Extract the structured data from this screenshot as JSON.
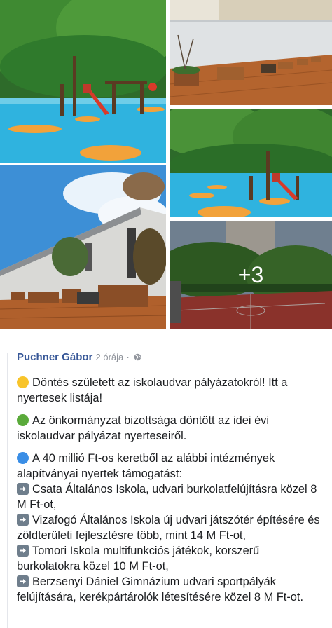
{
  "gallery": {
    "more_count": "+3",
    "photos": [
      {
        "name": "photo-playground-1",
        "desc_icon": "playground-icon"
      },
      {
        "name": "photo-courtyard-planters",
        "desc_icon": "planter-icon"
      },
      {
        "name": "photo-building-planters",
        "desc_icon": "building-icon"
      },
      {
        "name": "photo-playground-2",
        "desc_icon": "playground-icon"
      },
      {
        "name": "photo-sports-court",
        "desc_icon": "court-icon"
      }
    ]
  },
  "post": {
    "author": "Puchner Gábor",
    "time": "2 órája",
    "separator": "·",
    "privacy_icon": "globe-icon",
    "colors": {
      "author": "#385898",
      "meta": "#90949c",
      "text": "#1c1e21"
    },
    "paragraphs": {
      "p1": {
        "icon": "yellow-circle-icon",
        "text": "Döntés született az iskolaudvar pályázatokról! Itt a nyertesek listája!"
      },
      "p2": {
        "icon": "green-circle-icon",
        "text": "Az önkormányzat bizottsága döntött az idei évi iskolaudvar pályázat nyerteseiről."
      },
      "p3": {
        "icon": "blue-circle-icon",
        "text": "A 40 millió Ft-os keretből az alábbi intézmények alapítványai nyertek támogatást:"
      }
    },
    "winners": [
      {
        "icon": "right-arrow-icon",
        "text": "Csata Általános Iskola, udvari burkolatfelújításra közel 8 M Ft-ot,"
      },
      {
        "icon": "right-arrow-icon",
        "text": "Vizafogó Általános Iskola új udvari játszótér építésére és zöldterületi fejlesztésre több, mint 14 M Ft-ot,"
      },
      {
        "icon": "right-arrow-icon",
        "text": "Tomori Iskola multifunkciós játékok, korszerű burkolatokra közel 10 M Ft-ot,"
      },
      {
        "icon": "right-arrow-icon",
        "text": "Berzsenyi Dániel Gimnázium udvari sportpályák felújítására, kerékpártárolók létesítésére közel 8 M Ft-ot."
      }
    ]
  }
}
